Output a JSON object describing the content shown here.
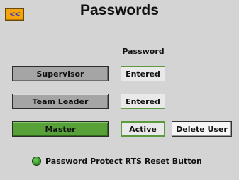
{
  "header": {
    "back_label": "<<",
    "title": "Passwords"
  },
  "column_header": "Password",
  "rows": [
    {
      "role": "Supervisor",
      "status": "Entered"
    },
    {
      "role": "Team Leader",
      "status": "Entered"
    },
    {
      "role": "Master",
      "status": "Active",
      "action": "Delete User"
    }
  ],
  "protect": {
    "label": "Password Protect RTS Reset Button",
    "led_color": "#3fa82f"
  },
  "colors": {
    "accent_orange": "#f4a50c",
    "active_green": "#58a038",
    "background": "#d4d4d4"
  }
}
